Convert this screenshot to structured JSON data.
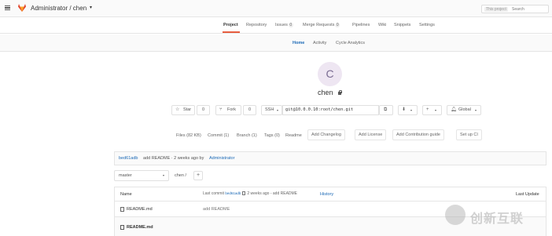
{
  "header": {
    "title": "Administrator / chen",
    "search_scope": "This project",
    "search_placeholder": "Search"
  },
  "project_nav": {
    "items": [
      {
        "label": "Project",
        "active": true
      },
      {
        "label": "Repository"
      },
      {
        "label": "Issues",
        "count": "0"
      },
      {
        "label": "Merge Requests",
        "count": "0"
      },
      {
        "label": "Pipelines"
      },
      {
        "label": "Wiki"
      },
      {
        "label": "Snippets"
      },
      {
        "label": "Settings"
      }
    ]
  },
  "sub_nav": {
    "items": [
      {
        "label": "Home",
        "active": true
      },
      {
        "label": "Activity"
      },
      {
        "label": "Cycle Analytics"
      }
    ]
  },
  "project": {
    "avatar_letter": "C",
    "name": "chen",
    "visibility_icon": "lock-icon"
  },
  "actions": {
    "star_label": "Star",
    "star_count": "0",
    "fork_label": "Fork",
    "fork_count": "0",
    "protocol": "SSH",
    "clone_url": "git@10.0.0.10:root/chen.git",
    "notification_label": "Global"
  },
  "stats": {
    "files": "Files (82 KB)",
    "commits": "Commit (1)",
    "branches": "Branch (1)",
    "tags": "Tags (0)",
    "readme": "Readme",
    "add_changelog": "Add Changelog",
    "add_license": "Add License",
    "add_contribution": "Add Contribution guide",
    "setup_ci": "Set up CI"
  },
  "last_commit": {
    "sha": "bed61adb",
    "message": "add README · 2 weeks ago by",
    "author": "Administrator"
  },
  "tree": {
    "branch": "master",
    "path": "chen /",
    "plus": "+"
  },
  "file_table": {
    "columns": {
      "name": "Name",
      "last_commit_label": "Last commit",
      "last_commit_sha": "bed61adb",
      "last_commit_text": "2 weeks ago - add README",
      "history": "History",
      "last_update": "Last Update"
    },
    "rows": [
      {
        "name": "README.md",
        "commit": "add README"
      }
    ],
    "readme_title": "README.md"
  },
  "watermark": {
    "text": "创新互联"
  },
  "colors": {
    "accent": "#e75e40",
    "link": "#1b69b6"
  }
}
